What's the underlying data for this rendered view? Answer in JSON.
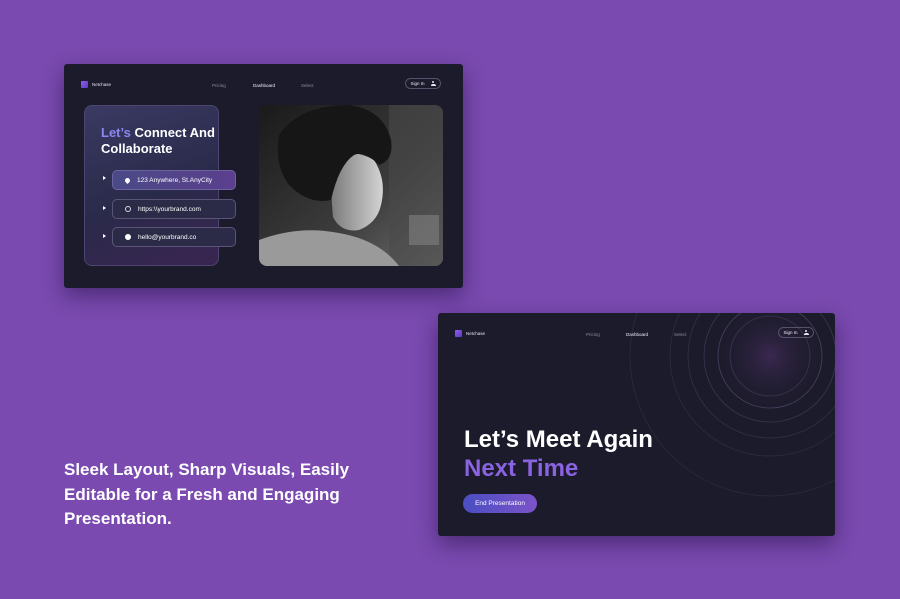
{
  "slide1": {
    "nav": {
      "brand": "Netchase",
      "links": [
        "Pricing",
        "Dashboard",
        "Select"
      ],
      "active_link": "Dashboard",
      "signin": "Sign In"
    },
    "card": {
      "title_accent": "Let’s",
      "title_rest": "Connect And Collaborate",
      "items": [
        {
          "icon": "map-pin-icon",
          "text": "123 Anywhere, St.AnyCity"
        },
        {
          "icon": "globe-icon",
          "text": "https:\\\\yourbrand.com"
        },
        {
          "icon": "mail-icon",
          "text": "hello@yourbrand.co"
        }
      ]
    }
  },
  "slide2": {
    "nav": {
      "brand": "Netchase",
      "links": [
        "Pricing",
        "Dashboard",
        "Select"
      ],
      "active_link": "Dashboard",
      "signin": "Sign In"
    },
    "title_line1": "Let’s Meet Again",
    "title_line2": "Next Time",
    "button": "End Presentation"
  },
  "tagline": "Sleek Layout, Sharp Visuals, Easily Editable for a Fresh and Engaging Presentation.",
  "colors": {
    "background": "#7a4ab0",
    "slide_bg": "#1c1b2b",
    "accent_blue": "#8b86f0",
    "accent_purple": "#8a63e0"
  }
}
